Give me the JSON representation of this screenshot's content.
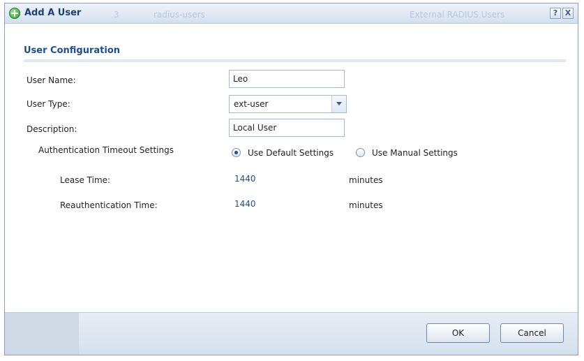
{
  "dialog": {
    "title": "Add A User",
    "background_ghost": {
      "id": "3",
      "name": "radius-users",
      "type": "External RADIUS Users"
    },
    "help_label": "?",
    "close_label": "X"
  },
  "section": {
    "title": "User Configuration"
  },
  "form": {
    "user_name": {
      "label": "User Name:",
      "value": "Leo"
    },
    "user_type": {
      "label": "User Type:",
      "value": "ext-user"
    },
    "description": {
      "label": "Description:",
      "value": "Local User"
    },
    "auth_timeout": {
      "label": "Authentication Timeout Settings",
      "option_default": "Use Default Settings",
      "option_manual": "Use Manual Settings",
      "selected": "default"
    },
    "lease_time": {
      "label": "Lease Time:",
      "value": "1440",
      "unit": "minutes"
    },
    "reauth_time": {
      "label": "Reauthentication Time:",
      "value": "1440",
      "unit": "minutes"
    }
  },
  "footer": {
    "ok_label": "OK",
    "cancel_label": "Cancel"
  },
  "colors": {
    "title_blue": "#1b3f77",
    "section_blue": "#1b4e8c",
    "value_blue": "#1f4e8c",
    "border": "#8a9fbd"
  }
}
